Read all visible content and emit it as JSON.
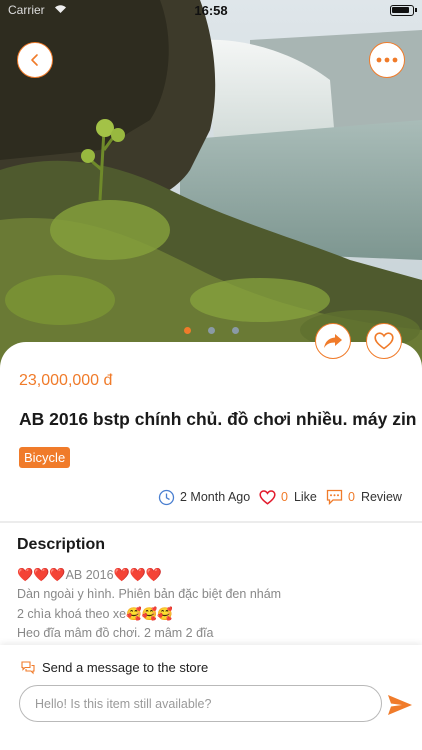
{
  "status_bar": {
    "carrier": "Carrier",
    "time": "16:58"
  },
  "gallery": {
    "dot_count": 3,
    "active_index": 0
  },
  "product": {
    "price": "23,000,000 đ",
    "title": "AB 2016 bstp chính chủ. đồ chơi nhiều. máy zin",
    "category": "Bicycle"
  },
  "meta": {
    "time_label": "2 Month Ago",
    "like_count": "0",
    "like_label": "Like",
    "review_count": "0",
    "review_label": "Review"
  },
  "description": {
    "heading": "Description",
    "line1_text": "AB 2016",
    "line2": "Dàn ngoài y hình. Phiên bản đặc biệt đen nhám",
    "line3_text": "2 chìa khoá theo xe",
    "line4": "Heo đĩa mâm đồ chơi. 2 mâm 2 đĩa"
  },
  "message": {
    "label": "Send a message to the store",
    "placeholder": "Hello! Is this item still available?"
  },
  "colors": {
    "accent": "#f07b2a",
    "heart": "#e21b2d"
  },
  "icons": [
    "back-icon",
    "more-icon",
    "share-icon",
    "heart-icon",
    "clock-icon",
    "comment-icon",
    "chat-icon",
    "send-icon"
  ]
}
